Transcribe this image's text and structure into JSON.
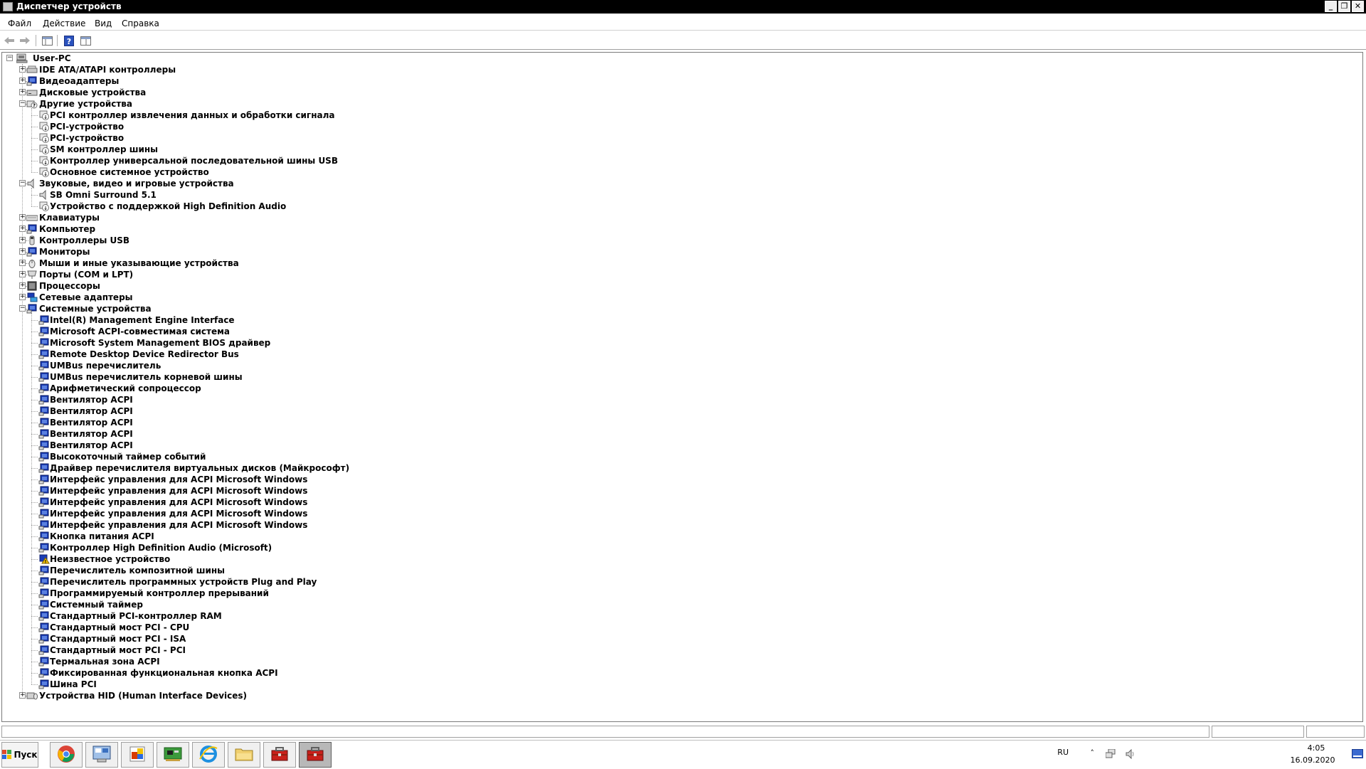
{
  "window": {
    "title": "Диспетчер устройств",
    "minimize": "_",
    "restore": "❐",
    "close": "✕"
  },
  "menu": [
    "Файл",
    "Действие",
    "Вид",
    "Справка"
  ],
  "tree": {
    "root": "User-PC",
    "nodes": [
      {
        "label": "IDE ATA/ATAPI контроллеры",
        "level": 1,
        "expander": "+",
        "icon": "ide-controller-icon"
      },
      {
        "label": "Видеоадаптеры",
        "level": 1,
        "expander": "+",
        "icon": "display-adapter-icon"
      },
      {
        "label": "Дисковые устройства",
        "level": 1,
        "expander": "+",
        "icon": "disk-drive-icon"
      },
      {
        "label": "Другие устройства",
        "level": 1,
        "expander": "-",
        "icon": "other-devices-icon"
      },
      {
        "label": "PCI контроллер извлечения данных и обработки сигнала",
        "level": 2,
        "icon": "unknown-device-icon"
      },
      {
        "label": "PCI-устройство",
        "level": 2,
        "icon": "unknown-device-icon"
      },
      {
        "label": "PCI-устройство",
        "level": 2,
        "icon": "unknown-device-icon"
      },
      {
        "label": "SM контроллер шины",
        "level": 2,
        "icon": "unknown-device-icon"
      },
      {
        "label": "Контроллер универсальной последовательной шины USB",
        "level": 2,
        "icon": "unknown-device-icon"
      },
      {
        "label": "Основное системное устройство",
        "level": 2,
        "icon": "unknown-device-icon"
      },
      {
        "label": "Звуковые, видео и игровые устройства",
        "level": 1,
        "expander": "-",
        "icon": "sound-icon"
      },
      {
        "label": "SB Omni Surround 5.1",
        "level": 2,
        "icon": "sound-icon"
      },
      {
        "label": "Устройство с поддержкой High Definition Audio",
        "level": 2,
        "icon": "unknown-device-icon"
      },
      {
        "label": "Клавиатуры",
        "level": 1,
        "expander": "+",
        "icon": "keyboard-icon"
      },
      {
        "label": "Компьютер",
        "level": 1,
        "expander": "+",
        "icon": "computer-icon"
      },
      {
        "label": "Контроллеры USB",
        "level": 1,
        "expander": "+",
        "icon": "usb-icon"
      },
      {
        "label": "Мониторы",
        "level": 1,
        "expander": "+",
        "icon": "monitor-icon"
      },
      {
        "label": "Мыши и иные указывающие устройства",
        "level": 1,
        "expander": "+",
        "icon": "mouse-icon"
      },
      {
        "label": "Порты (COM и LPT)",
        "level": 1,
        "expander": "+",
        "icon": "port-icon"
      },
      {
        "label": "Процессоры",
        "level": 1,
        "expander": "+",
        "icon": "processor-icon"
      },
      {
        "label": "Сетевые адаптеры",
        "level": 1,
        "expander": "+",
        "icon": "network-adapter-icon"
      },
      {
        "label": "Системные устройства",
        "level": 1,
        "expander": "-",
        "icon": "system-device-icon"
      },
      {
        "label": "Intel(R) Management Engine Interface",
        "level": 2,
        "icon": "system-device-icon"
      },
      {
        "label": "Microsoft ACPI-совместимая система",
        "level": 2,
        "icon": "system-device-icon"
      },
      {
        "label": "Microsoft System Management BIOS драйвер",
        "level": 2,
        "icon": "system-device-icon"
      },
      {
        "label": "Remote Desktop Device Redirector Bus",
        "level": 2,
        "icon": "system-device-icon"
      },
      {
        "label": "UMBus перечислитель",
        "level": 2,
        "icon": "system-device-icon"
      },
      {
        "label": "UMBus перечислитель корневой шины",
        "level": 2,
        "icon": "system-device-icon"
      },
      {
        "label": "Арифметический сопроцессор",
        "level": 2,
        "icon": "system-device-icon"
      },
      {
        "label": "Вентилятор ACPI",
        "level": 2,
        "icon": "system-device-icon"
      },
      {
        "label": "Вентилятор ACPI",
        "level": 2,
        "icon": "system-device-icon"
      },
      {
        "label": "Вентилятор ACPI",
        "level": 2,
        "icon": "system-device-icon"
      },
      {
        "label": "Вентилятор ACPI",
        "level": 2,
        "icon": "system-device-icon"
      },
      {
        "label": "Вентилятор ACPI",
        "level": 2,
        "icon": "system-device-icon"
      },
      {
        "label": "Высокоточный таймер событий",
        "level": 2,
        "icon": "system-device-icon"
      },
      {
        "label": "Драйвер перечислителя виртуальных дисков (Майкрософт)",
        "level": 2,
        "icon": "system-device-icon"
      },
      {
        "label": "Интерфейс управления для ACPI Microsoft Windows",
        "level": 2,
        "icon": "system-device-icon"
      },
      {
        "label": "Интерфейс управления для ACPI Microsoft Windows",
        "level": 2,
        "icon": "system-device-icon"
      },
      {
        "label": "Интерфейс управления для ACPI Microsoft Windows",
        "level": 2,
        "icon": "system-device-icon"
      },
      {
        "label": "Интерфейс управления для ACPI Microsoft Windows",
        "level": 2,
        "icon": "system-device-icon"
      },
      {
        "label": "Интерфейс управления для ACPI Microsoft Windows",
        "level": 2,
        "icon": "system-device-icon"
      },
      {
        "label": "Кнопка питания ACPI",
        "level": 2,
        "icon": "system-device-icon"
      },
      {
        "label": "Контроллер High Definition Audio (Microsoft)",
        "level": 2,
        "icon": "system-device-icon"
      },
      {
        "label": "Неизвестное устройство",
        "level": 2,
        "icon": "warning-device-icon"
      },
      {
        "label": "Перечислитель композитной шины",
        "level": 2,
        "icon": "system-device-icon"
      },
      {
        "label": "Перечислитель программных устройств Plug and Play",
        "level": 2,
        "icon": "system-device-icon"
      },
      {
        "label": "Программируемый контроллер прерываний",
        "level": 2,
        "icon": "system-device-icon"
      },
      {
        "label": "Системный таймер",
        "level": 2,
        "icon": "system-device-icon"
      },
      {
        "label": "Стандартный PCI-контроллер RAM",
        "level": 2,
        "icon": "system-device-icon"
      },
      {
        "label": "Стандартный мост PCI  - CPU",
        "level": 2,
        "icon": "system-device-icon"
      },
      {
        "label": "Стандартный мост PCI - ISA",
        "level": 2,
        "icon": "system-device-icon"
      },
      {
        "label": "Стандартный мост PCI - PCI",
        "level": 2,
        "icon": "system-device-icon"
      },
      {
        "label": "Термальная зона ACPI",
        "level": 2,
        "icon": "system-device-icon"
      },
      {
        "label": "Фиксированная функциональная кнопка ACPI",
        "level": 2,
        "icon": "system-device-icon"
      },
      {
        "label": "Шина PCI",
        "level": 2,
        "icon": "system-device-icon"
      },
      {
        "label": "Устройства HID (Human Interface Devices)",
        "level": 1,
        "expander": "+",
        "icon": "hid-icon"
      }
    ]
  },
  "taskbar": {
    "start_label": "Пуск",
    "apps": [
      {
        "name": "chrome-icon",
        "active": false
      },
      {
        "name": "control-panel-icon",
        "active": false
      },
      {
        "name": "office-icon",
        "active": false
      },
      {
        "name": "hardware-icon",
        "active": false
      },
      {
        "name": "internet-explorer-icon",
        "active": false
      },
      {
        "name": "explorer-folder-icon",
        "active": false
      },
      {
        "name": "toolbox-icon",
        "active": false
      },
      {
        "name": "toolbox-icon",
        "active": true
      }
    ],
    "lang": "RU",
    "time": "4:05",
    "date": "16.09.2020"
  },
  "colors": {
    "titlebar": "#000000",
    "device_blue": "#1a3cb4",
    "warning_yellow": "#f2c200"
  }
}
